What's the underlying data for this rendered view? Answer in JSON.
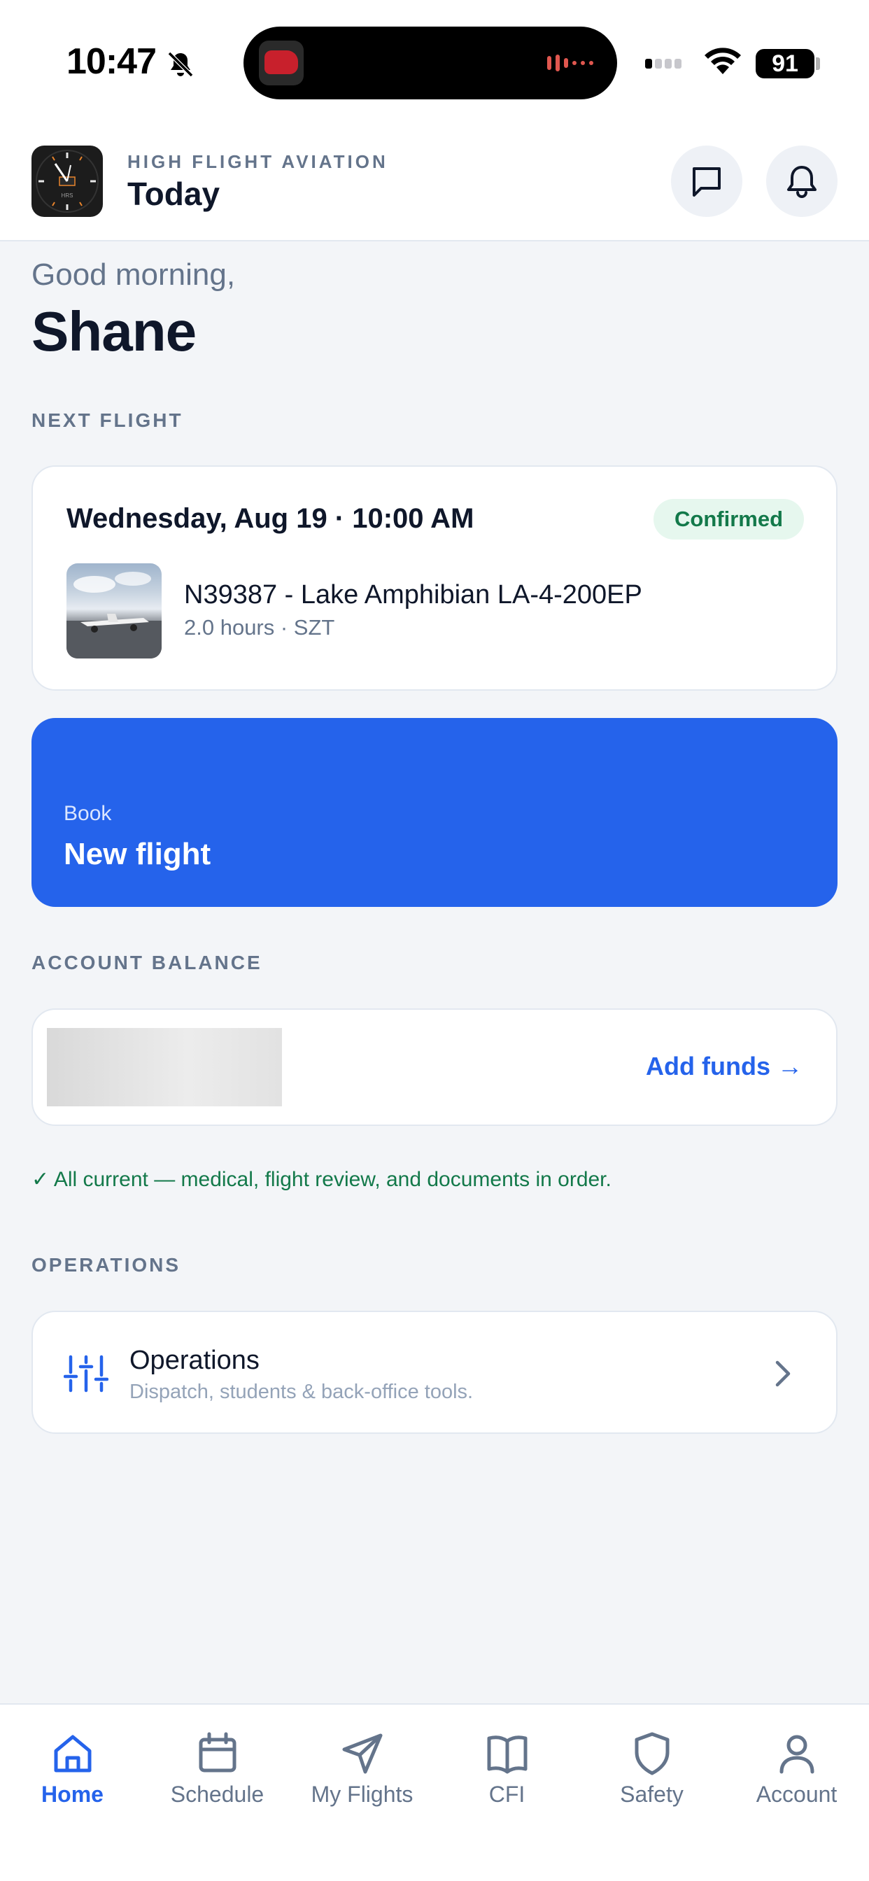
{
  "status_bar": {
    "time": "10:47",
    "battery": "91"
  },
  "header": {
    "org_name": "HIGH FLIGHT AVIATION",
    "title": "Today",
    "logo_text": "HRS"
  },
  "greeting": {
    "salutation": "Good morning,",
    "name": "Shane"
  },
  "next_flight": {
    "section_label": "NEXT FLIGHT",
    "date_time": "Wednesday, Aug 19 · 10:00 AM",
    "status": "Confirmed",
    "aircraft": "N39387 - Lake Amphibian LA-4-200EP",
    "meta": "2.0 hours · SZT"
  },
  "book": {
    "subtitle": "Book",
    "title": "New flight"
  },
  "account_balance": {
    "section_label": "ACCOUNT BALANCE",
    "add_funds_label": "Add funds →"
  },
  "compliance_text": "✓ All current — medical, flight review, and documents in order.",
  "operations": {
    "section_label": "OPERATIONS",
    "title": "Operations",
    "subtitle": "Dispatch, students & back-office tools."
  },
  "tabs": [
    {
      "label": "Home",
      "icon": "home-icon",
      "active": true
    },
    {
      "label": "Schedule",
      "icon": "calendar-icon",
      "active": false
    },
    {
      "label": "My Flights",
      "icon": "paper-plane-icon",
      "active": false
    },
    {
      "label": "CFI",
      "icon": "book-icon",
      "active": false
    },
    {
      "label": "Safety",
      "icon": "shield-icon",
      "active": false
    },
    {
      "label": "Account",
      "icon": "user-icon",
      "active": false
    }
  ],
  "colors": {
    "accent": "#2563eb",
    "success": "#13794a",
    "background": "#f3f5f8",
    "muted": "#64748b"
  }
}
